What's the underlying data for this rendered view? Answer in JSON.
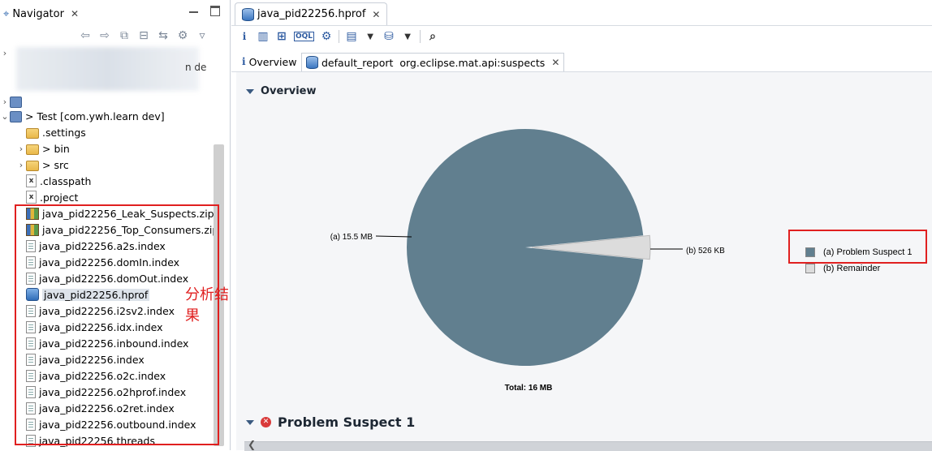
{
  "navigator": {
    "title": "Navigator",
    "blurred_suffix": "n de",
    "tree": [
      {
        "label": "> Test [com.ywh.learn dev]",
        "icon": "project",
        "twisty": "v",
        "indent": 0
      },
      {
        "label": ".settings",
        "icon": "folder",
        "twisty": "",
        "indent": 1
      },
      {
        "label": "> bin",
        "icon": "folder",
        "twisty": ">",
        "indent": 1
      },
      {
        "label": "> src",
        "icon": "folder",
        "twisty": ">",
        "indent": 1
      },
      {
        "label": ".classpath",
        "icon": "xml",
        "twisty": "",
        "indent": 1
      },
      {
        "label": ".project",
        "icon": "xml",
        "twisty": "",
        "indent": 1
      },
      {
        "label": "java_pid22256_Leak_Suspects.zip",
        "icon": "zip",
        "twisty": "",
        "indent": 1
      },
      {
        "label": "java_pid22256_Top_Consumers.zip",
        "icon": "zip",
        "twisty": "",
        "indent": 1
      },
      {
        "label": "java_pid22256.a2s.index",
        "icon": "file",
        "twisty": "",
        "indent": 1
      },
      {
        "label": "java_pid22256.domIn.index",
        "icon": "file",
        "twisty": "",
        "indent": 1
      },
      {
        "label": "java_pid22256.domOut.index",
        "icon": "file",
        "twisty": "",
        "indent": 1
      },
      {
        "label": "java_pid22256.hprof",
        "icon": "heap",
        "twisty": "",
        "indent": 1,
        "selected": true
      },
      {
        "label": "java_pid22256.i2sv2.index",
        "icon": "file",
        "twisty": "",
        "indent": 1
      },
      {
        "label": "java_pid22256.idx.index",
        "icon": "file",
        "twisty": "",
        "indent": 1
      },
      {
        "label": "java_pid22256.inbound.index",
        "icon": "file",
        "twisty": "",
        "indent": 1
      },
      {
        "label": "java_pid22256.index",
        "icon": "file",
        "twisty": "",
        "indent": 1
      },
      {
        "label": "java_pid22256.o2c.index",
        "icon": "file",
        "twisty": "",
        "indent": 1
      },
      {
        "label": "java_pid22256.o2hprof.index",
        "icon": "file",
        "twisty": "",
        "indent": 1
      },
      {
        "label": "java_pid22256.o2ret.index",
        "icon": "file",
        "twisty": "",
        "indent": 1
      },
      {
        "label": "java_pid22256.outbound.index",
        "icon": "file",
        "twisty": "",
        "indent": 1
      },
      {
        "label": "java_pid22256.threads",
        "icon": "file",
        "twisty": "",
        "indent": 1
      }
    ]
  },
  "annotation": "分析结果",
  "editor": {
    "tab_label": "java_pid22256.hprof",
    "subtabs": {
      "overview": "Overview",
      "report": "default_report  org.eclipse.mat.api:suspects"
    },
    "overview_heading": "Overview",
    "problem_heading": "Problem Suspect 1"
  },
  "colors": {
    "suspect": "#617f8f",
    "remainder": "#dcdcdc",
    "highlight": "#e02020"
  },
  "chart_data": {
    "type": "pie",
    "slices": [
      {
        "label": "(a)  15.5 MB",
        "legend": "(a)  Problem Suspect 1",
        "value": 15.5
      },
      {
        "label": "(b)  526 KB",
        "legend": "(b)  Remainder",
        "value": 0.514
      }
    ],
    "total_label": "Total: 16 MB",
    "legend_position": "right"
  }
}
